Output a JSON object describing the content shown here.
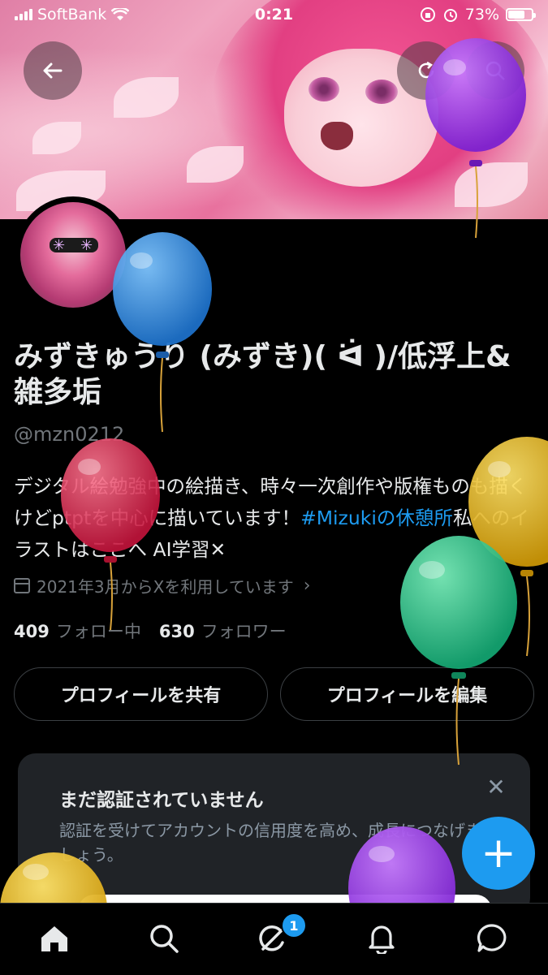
{
  "status_bar": {
    "carrier": "SoftBank",
    "time": "0:21",
    "battery_text": "73%",
    "battery_level": 0.73
  },
  "profile": {
    "display_name": "みずきゅうり (みずき)( ᐛ )/低浮上&雑多垢",
    "handle": "@mzn0212",
    "bio_part1": "デジタル絵勉強中の絵描き、時々一次創作や版権ものも描くけどptptを中心に描いています！",
    "bio_hashtag": "#Mizukiの休憩所",
    "bio_part2": "私へのイラストはここへ AI学習✕",
    "joined": "2021年3月からXを利用しています",
    "following_count": "409",
    "following_label": "フォロー中",
    "followers_count": "630",
    "followers_label": "フォロワー"
  },
  "buttons": {
    "share_profile": "プロフィールを共有",
    "edit_profile": "プロフィールを編集"
  },
  "verify_card": {
    "title": "まだ認証されていません",
    "description": "認証を受けてアカウントの信用度を高め、成長につなげましょう。",
    "close_glyph": "✕"
  },
  "fab": {
    "glyph": "+"
  },
  "bottom_nav": {
    "items": [
      "home-icon",
      "search-icon",
      "grok-icon",
      "bell-icon",
      "message-icon"
    ],
    "notification_badge": "1"
  },
  "colors": {
    "accent": "#1d9bf0",
    "background": "#000000",
    "secondary_text": "#71767b",
    "card_background": "#202327"
  }
}
